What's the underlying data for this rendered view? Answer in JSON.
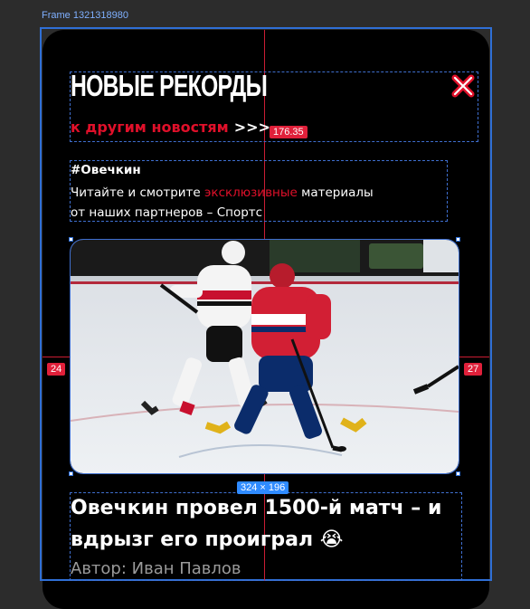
{
  "frame": {
    "name": "Frame 1321318980"
  },
  "header": {
    "title": "НОВЫЕ РЕКОРДЫ",
    "back_link_label": "к другим новостям",
    "back_link_arrows": ">>>"
  },
  "article": {
    "tag": "#Овечкин",
    "desc_line1_before": "Читайте и смотрите ",
    "desc_line1_highlight": "эксклюзивные",
    "desc_line1_after": " материалы",
    "desc_line2": "от наших партнеров – Спортс",
    "headline": "Овечкин провел 1500-й матч – и вдрызг его проиграл 😭",
    "author": "Автор: Иван Павлов"
  },
  "measurements": {
    "top_gap": "176.35",
    "left_gap": "24",
    "right_gap": "27",
    "image_size": "324 × 196"
  },
  "colors": {
    "accent": "#e0102a",
    "background": "#000000",
    "selection": "#2f6fd6"
  }
}
